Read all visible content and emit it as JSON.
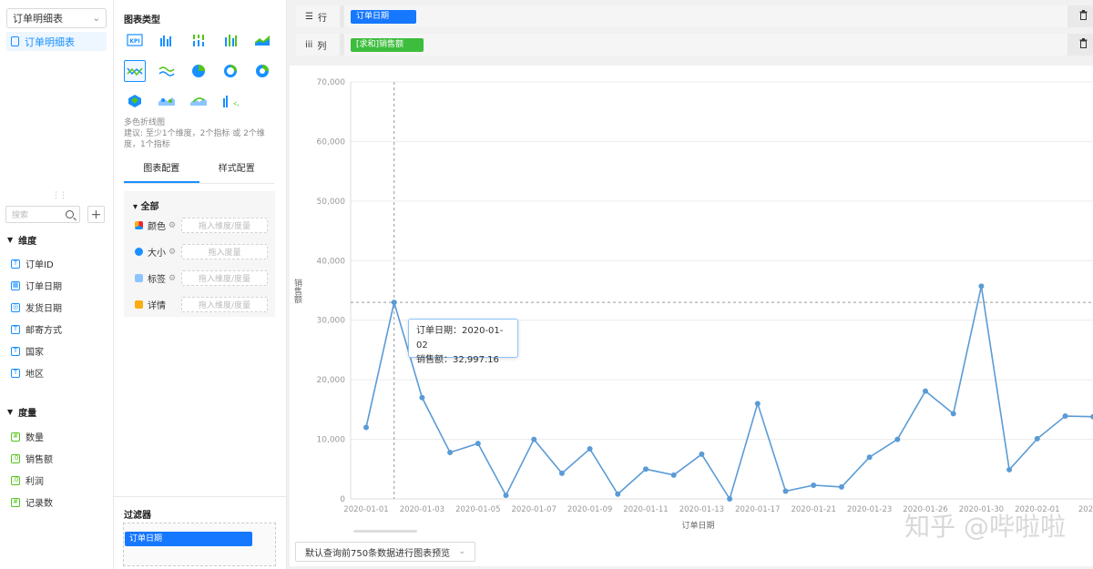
{
  "datasource": {
    "selected": "订单明细表",
    "item": "订单明细表"
  },
  "search": {
    "placeholder": "搜索"
  },
  "dimensions": {
    "title": "维度",
    "fields": [
      "订单ID",
      "订单日期",
      "发货日期",
      "邮寄方式",
      "国家",
      "地区"
    ]
  },
  "measures": {
    "title": "度量",
    "fields": [
      "数量",
      "销售额",
      "利润",
      "记录数"
    ]
  },
  "chart_types": {
    "title": "图表类型",
    "selected_name": "多色折线图",
    "hint": "建议: 至少1个维度，2个指标 或 2个维度，1个指标"
  },
  "config_tabs": [
    "图表配置",
    "样式配置"
  ],
  "marks": {
    "section": "全部",
    "rows": [
      {
        "label": "颜色",
        "drop": "拖入维度/度量"
      },
      {
        "label": "大小",
        "drop": "拖入度量"
      },
      {
        "label": "标签",
        "drop": "拖入维度/度量"
      },
      {
        "label": "详情",
        "drop": "拖入维度/度量"
      }
    ]
  },
  "filter": {
    "title": "过滤器",
    "chip": "订单日期"
  },
  "shelves": {
    "rows_label": "行",
    "rows_pill": "订单日期",
    "cols_label": "列",
    "cols_pill": "[求和]销售额"
  },
  "preview": {
    "label": "默认查询前750条数据进行图表预览"
  },
  "tooltip": {
    "line1": "订单日期：2020-01-02",
    "line2": "销售额：32,997.16"
  },
  "watermark": "知乎 @哔啦啦",
  "colors": {
    "accent": "#1890ff",
    "line": "#5b9bd5",
    "green": "#52c41a"
  },
  "chart_data": {
    "type": "line",
    "xlabel": "订单日期",
    "ylabel": "销售额",
    "ylim": [
      0,
      70000
    ],
    "yticks": [
      "0",
      "10,000",
      "20,000",
      "30,000",
      "40,000",
      "50,000",
      "60,000",
      "70,000"
    ],
    "xtick_labels": [
      "2020-01-01",
      "2020-01-03",
      "2020-01-05",
      "2020-01-07",
      "2020-01-09",
      "2020-01-11",
      "2020-01-13",
      "2020-01-17",
      "2020-01-21",
      "2020-01-23",
      "2020-01-26",
      "2020-01-30",
      "2020-02-01",
      "202"
    ],
    "series": [
      {
        "values": [
          12000,
          32997.16,
          17000,
          7800,
          9300,
          600,
          10000,
          4300,
          8400,
          800,
          5000,
          4000,
          7500,
          0,
          16000,
          1300,
          2300,
          2000,
          7000,
          10000,
          18100,
          14300,
          35700,
          4900,
          10100,
          13900,
          13800
        ]
      }
    ],
    "grid": true
  }
}
